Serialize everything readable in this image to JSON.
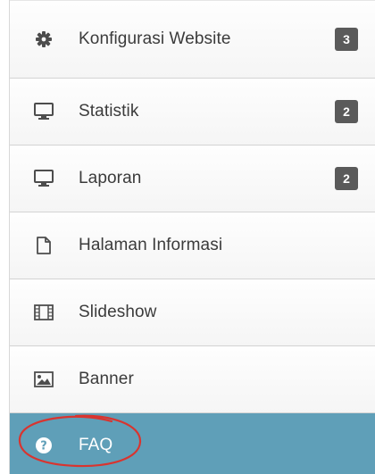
{
  "menu": {
    "items": [
      {
        "label": "Konfigurasi Website",
        "icon": "gear-icon",
        "badge": "3",
        "active": false
      },
      {
        "label": "Statistik",
        "icon": "monitor-icon",
        "badge": "2",
        "active": false
      },
      {
        "label": "Laporan",
        "icon": "monitor-icon",
        "badge": "2",
        "active": false
      },
      {
        "label": "Halaman Informasi",
        "icon": "document-icon",
        "active": false
      },
      {
        "label": "Slideshow",
        "icon": "film-icon",
        "active": false
      },
      {
        "label": "Banner",
        "icon": "image-icon",
        "active": false
      },
      {
        "label": "FAQ",
        "icon": "question-circle-icon",
        "active": true
      }
    ]
  },
  "colors": {
    "active_background": "#5f9fb8",
    "badge_background": "#5a5a5a",
    "annotation_circle": "#d9342f"
  }
}
